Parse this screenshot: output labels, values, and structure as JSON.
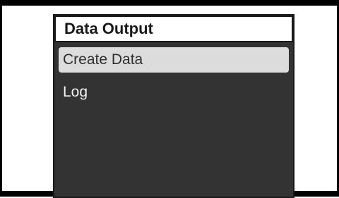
{
  "screen": {
    "title": "Data Output"
  },
  "menu": {
    "items": [
      {
        "label": "Create Data",
        "selected": true
      },
      {
        "label": "Log",
        "selected": false
      }
    ]
  },
  "colors": {
    "panel_bg": "#333333",
    "highlight_bg": "#dcdcdc",
    "frame": "#000000"
  }
}
